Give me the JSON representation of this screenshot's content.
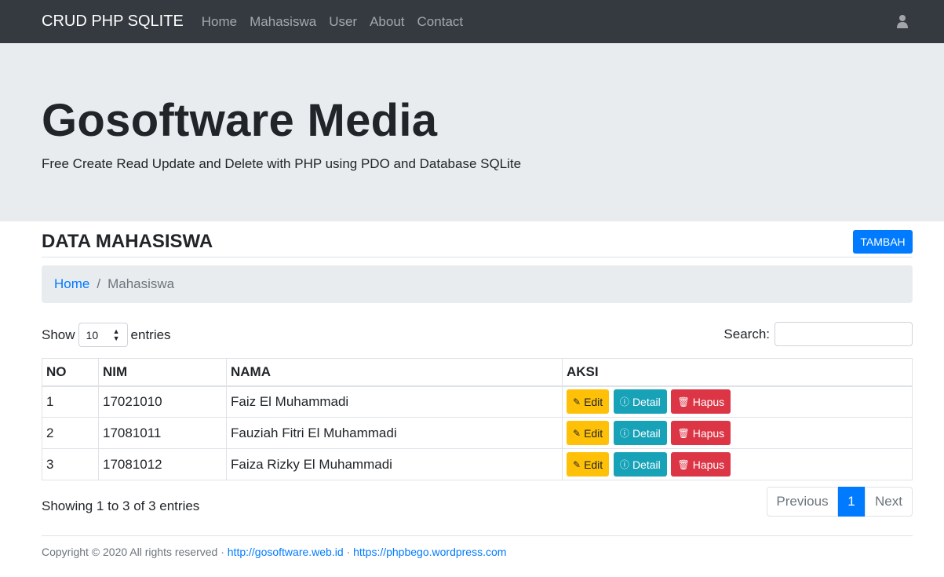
{
  "navbar": {
    "brand": "CRUD PHP SQLITE",
    "links": [
      "Home",
      "Mahasiswa",
      "User",
      "About",
      "Contact"
    ],
    "user_icon": "user-icon"
  },
  "jumbotron": {
    "title": "Gosoftware Media",
    "subtitle": "Free Create Read Update and Delete with PHP using PDO and Database SQLite"
  },
  "section": {
    "title": "DATA MAHASISWA",
    "add_button": "TAMBAH"
  },
  "breadcrumb": {
    "home": "Home",
    "separator": "/",
    "active": "Mahasiswa"
  },
  "datatable": {
    "show_label": "Show",
    "length_value": "10",
    "entries_label": "entries",
    "search_label": "Search:",
    "search_value": "",
    "columns": [
      "NO",
      "NIM",
      "NAMA",
      "AKSI"
    ],
    "rows": [
      {
        "no": "1",
        "nim": "17021010",
        "nama": "Faiz El Muhammadi"
      },
      {
        "no": "2",
        "nim": "17081011",
        "nama": "Fauziah Fitri El Muhammadi"
      },
      {
        "no": "3",
        "nim": "17081012",
        "nama": "Faiza Rizky El Muhammadi"
      }
    ],
    "actions": {
      "edit": "Edit",
      "detail": "Detail",
      "hapus": "Hapus"
    },
    "info": "Showing 1 to 3 of 3 entries",
    "pagination": {
      "previous": "Previous",
      "current": "1",
      "next": "Next"
    }
  },
  "footer": {
    "text": "Copyright © 2020 All rights reserved ·",
    "link1": "http://gosoftware.web.id",
    "sep": "·",
    "link2": "https://phpbego.wordpress.com"
  },
  "colors": {
    "navbar": "#343a40",
    "primary": "#007bff",
    "warning": "#ffc107",
    "info": "#17a2b8",
    "danger": "#dc3545",
    "jumbotron": "#e9ecef"
  }
}
